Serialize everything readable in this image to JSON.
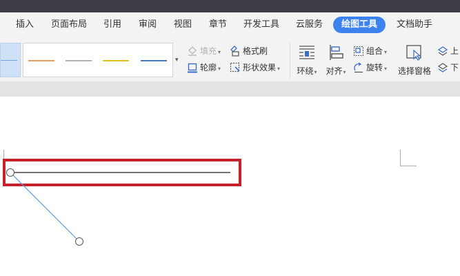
{
  "menu": {
    "tabs": [
      {
        "label": "插入"
      },
      {
        "label": "页面布局"
      },
      {
        "label": "引用"
      },
      {
        "label": "审阅"
      },
      {
        "label": "视图"
      },
      {
        "label": "章节"
      },
      {
        "label": "开发工具"
      },
      {
        "label": "云服务"
      },
      {
        "label": "绘图工具",
        "active": true
      },
      {
        "label": "文档助手"
      }
    ]
  },
  "ribbon": {
    "style_swatch_colors": [
      "#e8a05a",
      "#b0b0b0",
      "#e0c020",
      "#4a78c8"
    ],
    "fill_label": "填充",
    "outline_label": "轮廓",
    "format_painter_label": "格式刷",
    "shape_effect_label": "形状效果",
    "wrap_label": "环绕",
    "align_label": "对齐",
    "group_label": "组合",
    "rotate_label": "旋转",
    "selection_pane_label": "选择窗格",
    "bring_forward_label": "上",
    "send_backward_label": "下"
  },
  "colors": {
    "active_tab": "#3c83f0",
    "highlight": "#c8202a",
    "connector_line": "#5b9bd5",
    "drawn_line": "#222222"
  }
}
